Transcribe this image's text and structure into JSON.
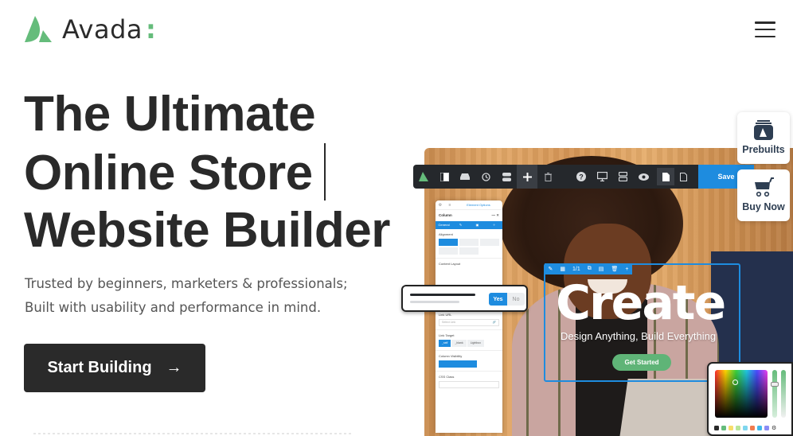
{
  "header": {
    "brand_name": "Avada",
    "brand_suffix": ":",
    "menu_icon": "hamburger-menu-icon"
  },
  "colors": {
    "brand_green": "#65bc7b",
    "dark": "#2a2a2a",
    "builder_blue": "#1e8cdf",
    "toolbar_dark": "#25282c"
  },
  "hero": {
    "headline_lines": [
      "The Ultimate",
      "Online Store",
      "Website Builder"
    ],
    "subtext_lines": [
      "Trusted by beginners, marketers & professionals;",
      "Built with usability and performance in mind."
    ],
    "cta_label": "Start Building",
    "cta_icon": "arrow-right-icon"
  },
  "side_actions": [
    {
      "label": "Prebuilts",
      "icon": "prebuilts-icon"
    },
    {
      "label": "Buy Now",
      "icon": "cart-icon"
    }
  ],
  "builder": {
    "toolbar_icons": [
      "avada-logo-icon",
      "sidebar-icon",
      "library-icon",
      "history-icon",
      "toggles-icon",
      "add-icon",
      "trash-icon",
      "help-icon",
      "desktop-icon",
      "layout-icon",
      "preview-icon",
      "page-icon",
      "page-outline-icon"
    ],
    "save_label": "Save",
    "panel": {
      "tab_label": "Element Options",
      "title": "Column",
      "subtabs": [
        "General"
      ],
      "sections": {
        "alignment": "Alignment",
        "content_layout": "Content Layout",
        "link_url": "Link URL",
        "link_url_placeholder": "Select Link",
        "link_target": "Link Target",
        "link_target_options": [
          "_self",
          "_blank",
          "Lightbox"
        ],
        "column_visibility": "Column Visibility",
        "css_class": "CSS Class"
      }
    },
    "toggle": {
      "yes": "Yes",
      "no": "No"
    },
    "selection_toolbar": {
      "counter": "1/1"
    },
    "canvas": {
      "headline": "Create",
      "tagline": "Design Anything, Build Everything",
      "button": "Get Started"
    },
    "color_picker": {
      "swatches": [
        "#2a2a2a",
        "#65bc7b",
        "#f7dd6a",
        "#b7e59a",
        "#7fd6ee",
        "#f07c4f",
        "#3fb9ea",
        "#8b8cf5"
      ]
    }
  }
}
